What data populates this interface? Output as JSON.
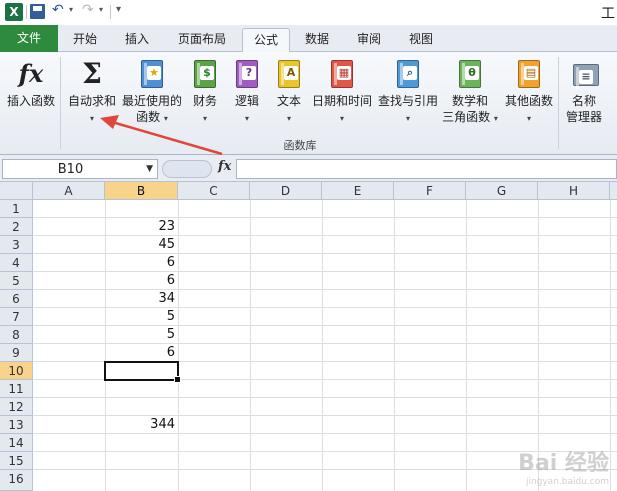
{
  "qat": {
    "app_icon": "X",
    "title_fragment": "工"
  },
  "tabs": [
    "文件",
    "开始",
    "插入",
    "页面布局",
    "公式",
    "数据",
    "审阅",
    "视图"
  ],
  "ribbon": {
    "insert_function": "插入函数",
    "autosum": "自动求和",
    "recent_l1": "最近使用的",
    "recent_l2": "函数",
    "financial": "财务",
    "logical": "逻辑",
    "text": "文本",
    "datetime": "日期和时间",
    "lookup": "查找与引用",
    "math_l1": "数学和",
    "math_l2": "三角函数",
    "more": "其他函数",
    "name_l1": "名称",
    "name_l2": "管理器",
    "group_label": "函数库",
    "caret": "▾"
  },
  "formula_bar": {
    "name_box": "B10",
    "fx": "fx",
    "formula": ""
  },
  "grid": {
    "columns": [
      "A",
      "B",
      "C",
      "D",
      "E",
      "F",
      "G",
      "H"
    ],
    "rows": [
      "1",
      "2",
      "3",
      "4",
      "5",
      "6",
      "7",
      "8",
      "9",
      "10",
      "11",
      "12",
      "13",
      "14",
      "15",
      "16"
    ],
    "selected_column": "B",
    "selected_row": "10",
    "cells": {
      "B2": "23",
      "B3": "45",
      "B4": "6",
      "B5": "6",
      "B6": "34",
      "B7": "5",
      "B8": "5",
      "B9": "6",
      "B13": "344"
    }
  },
  "watermark": {
    "main": "Bai  经验",
    "sub": "jingyan.baidu.com"
  },
  "colors": {
    "file_tab": "#2e8b3e",
    "selection_header": "#f8d38a",
    "arrow": "#e0463b"
  }
}
